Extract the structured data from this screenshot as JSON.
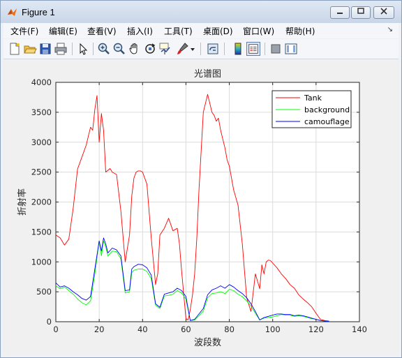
{
  "window": {
    "title": "Figure 1"
  },
  "menu": {
    "items": [
      "文件(F)",
      "编辑(E)",
      "查看(V)",
      "插入(I)",
      "工具(T)",
      "桌面(D)",
      "窗口(W)",
      "帮助(H)"
    ]
  },
  "toolbar": {
    "icons": [
      "new-figure-icon",
      "open-icon",
      "save-icon",
      "print-icon",
      "pointer-icon",
      "zoom-in-icon",
      "zoom-out-icon",
      "pan-icon",
      "rotate-icon",
      "data-cursor-icon",
      "brush-icon",
      "link-plot-icon",
      "colorbar-icon",
      "legend-icon",
      "hide-plot-tools-icon",
      "show-plot-tools-icon"
    ]
  },
  "chart_data": {
    "type": "line",
    "title": "光谱图",
    "xlabel": "波段数",
    "ylabel": "折射率",
    "xlim": [
      0,
      140
    ],
    "ylim": [
      0,
      4000
    ],
    "xticks": [
      0,
      20,
      40,
      60,
      80,
      100,
      120,
      140
    ],
    "yticks": [
      0,
      500,
      1000,
      1500,
      2000,
      2500,
      3000,
      3500,
      4000
    ],
    "grid": true,
    "legend_position": "top-right",
    "series": [
      {
        "name": "Tank",
        "color": "#ff0000",
        "x": [
          0,
          2,
          4,
          6,
          8,
          10,
          12,
          14,
          16,
          17,
          18,
          19,
          20,
          21,
          22,
          23,
          24,
          25,
          26,
          28,
          30,
          32,
          34,
          35,
          36,
          37,
          38,
          39,
          40,
          42,
          44,
          46,
          47,
          48,
          50,
          52,
          54,
          56,
          57,
          58,
          60,
          61,
          62,
          63,
          64,
          65,
          66,
          68,
          70,
          72,
          73,
          74,
          75,
          76,
          78,
          79,
          80,
          82,
          84,
          86,
          88,
          90,
          92,
          94,
          95,
          96,
          97,
          98,
          99,
          100,
          102,
          104,
          106,
          108,
          110,
          112,
          114,
          116,
          118,
          120,
          122,
          124,
          126
        ],
        "y": [
          1450,
          1400,
          1280,
          1380,
          1900,
          2550,
          2750,
          2950,
          3250,
          3200,
          3550,
          3780,
          3000,
          3480,
          3200,
          2500,
          2530,
          2560,
          2500,
          2460,
          1850,
          1000,
          1450,
          2100,
          2400,
          2500,
          2520,
          2520,
          2500,
          2300,
          1400,
          620,
          800,
          1450,
          1560,
          1730,
          1520,
          1560,
          1300,
          850,
          50,
          30,
          200,
          450,
          800,
          1400,
          2200,
          3500,
          3800,
          3500,
          3450,
          3350,
          3400,
          3200,
          2900,
          2700,
          2600,
          2200,
          1950,
          1300,
          400,
          170,
          800,
          550,
          950,
          800,
          1000,
          1030,
          1020,
          980,
          900,
          800,
          720,
          620,
          560,
          450,
          380,
          320,
          250,
          140,
          40,
          20,
          10
        ]
      },
      {
        "name": "background",
        "color": "#00ff00",
        "x": [
          0,
          2,
          4,
          6,
          8,
          10,
          12,
          14,
          16,
          18,
          20,
          21,
          22,
          23,
          24,
          26,
          28,
          30,
          32,
          34,
          35,
          36,
          38,
          40,
          42,
          44,
          46,
          48,
          50,
          52,
          54,
          56,
          58,
          60,
          62,
          64,
          66,
          68,
          70,
          72,
          74,
          76,
          78,
          80,
          82,
          84,
          86,
          88,
          90,
          92,
          94,
          96,
          98,
          100,
          102,
          104,
          106,
          108,
          110,
          112,
          114,
          116,
          118,
          120,
          122,
          124,
          126
        ],
        "y": [
          600,
          550,
          580,
          520,
          460,
          380,
          320,
          280,
          350,
          800,
          1350,
          1100,
          1350,
          1250,
          1100,
          1180,
          1170,
          1050,
          480,
          500,
          820,
          860,
          880,
          880,
          840,
          720,
          280,
          220,
          430,
          440,
          460,
          520,
          480,
          380,
          20,
          30,
          100,
          180,
          400,
          470,
          480,
          500,
          470,
          540,
          520,
          460,
          420,
          350,
          260,
          140,
          30,
          60,
          70,
          80,
          100,
          120,
          110,
          110,
          90,
          100,
          90,
          70,
          50,
          40,
          20,
          10,
          5
        ]
      },
      {
        "name": "camouflage",
        "color": "#0000ff",
        "x": [
          0,
          2,
          4,
          6,
          8,
          10,
          12,
          14,
          16,
          18,
          20,
          21,
          22,
          23,
          24,
          26,
          28,
          30,
          32,
          34,
          35,
          36,
          38,
          40,
          42,
          44,
          46,
          48,
          50,
          52,
          54,
          56,
          58,
          60,
          62,
          64,
          66,
          68,
          70,
          72,
          74,
          76,
          78,
          80,
          82,
          84,
          86,
          88,
          90,
          92,
          94,
          96,
          98,
          100,
          102,
          104,
          106,
          108,
          110,
          112,
          114,
          116,
          118,
          120,
          122,
          124,
          126
        ],
        "y": [
          650,
          580,
          600,
          560,
          500,
          450,
          390,
          360,
          420,
          880,
          1350,
          1180,
          1400,
          1300,
          1150,
          1230,
          1200,
          1100,
          520,
          530,
          880,
          920,
          960,
          950,
          900,
          780,
          300,
          240,
          460,
          480,
          500,
          560,
          520,
          420,
          20,
          40,
          130,
          220,
          450,
          530,
          560,
          600,
          560,
          620,
          580,
          520,
          470,
          400,
          300,
          170,
          30,
          70,
          90,
          110,
          130,
          130,
          120,
          120,
          100,
          110,
          100,
          80,
          60,
          40,
          20,
          10,
          5
        ]
      }
    ]
  }
}
